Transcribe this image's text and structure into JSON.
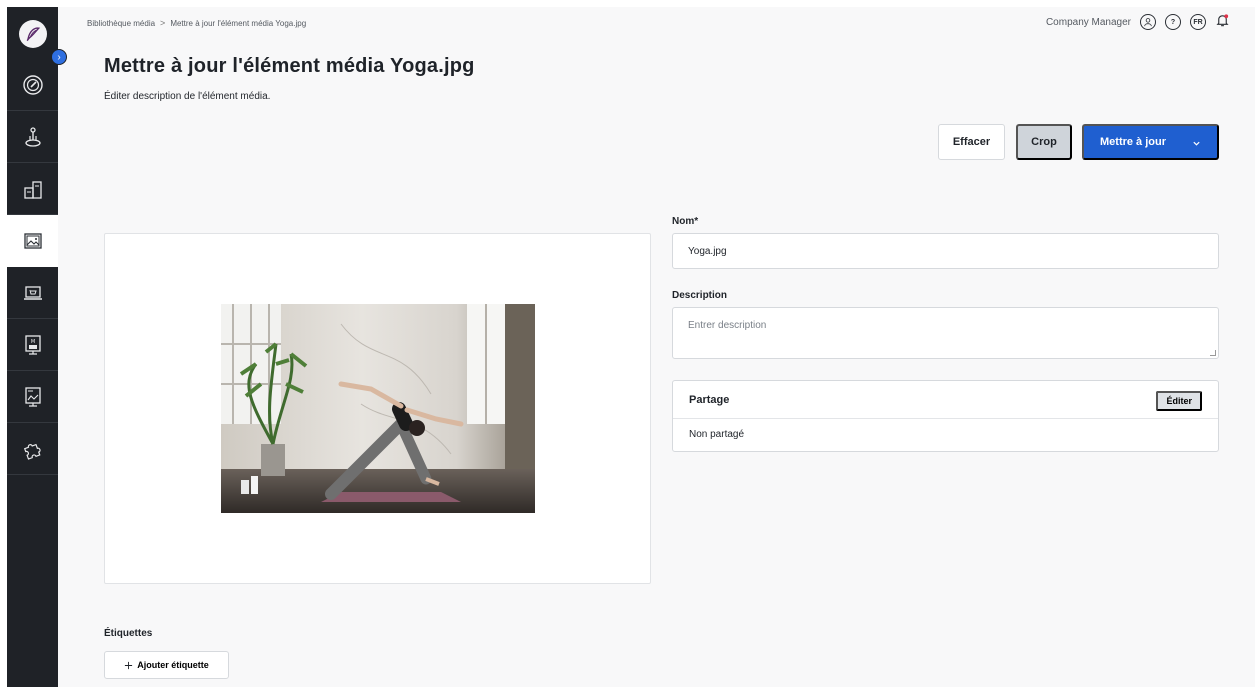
{
  "breadcrumb": {
    "items": [
      "Bibliothèque média",
      "Mettre à jour l'élément média Yoga.jpg"
    ],
    "separator": ">"
  },
  "topbar": {
    "user": "Company Manager",
    "lang": "FR"
  },
  "page": {
    "title": "Mettre à jour l'élément média Yoga.jpg",
    "subtitle": "Éditer description de l'élément média."
  },
  "actions": {
    "clear": "Effacer",
    "crop": "Crop",
    "update": "Mettre à jour"
  },
  "form": {
    "name_label": "Nom*",
    "name_value": "Yoga.jpg",
    "description_label": "Description",
    "description_placeholder": "Entrer description",
    "sharing_title": "Partage",
    "sharing_edit": "Éditer",
    "sharing_value": "Non partagé"
  },
  "tags": {
    "label": "Étiquettes",
    "add_button": "Ajouter étiquette"
  },
  "colors": {
    "primary": "#1f5fd0",
    "sidebar": "#1f2227",
    "background": "#f8f8f9"
  },
  "sidebar": {
    "items": [
      {
        "icon": "speedometer-icon"
      },
      {
        "icon": "joystick-icon"
      },
      {
        "icon": "products-icon"
      },
      {
        "icon": "media-icon",
        "active": true
      },
      {
        "icon": "laptop-cart-icon"
      },
      {
        "icon": "media-screen-icon"
      },
      {
        "icon": "presentation-icon"
      },
      {
        "icon": "puzzle-icon"
      }
    ]
  }
}
